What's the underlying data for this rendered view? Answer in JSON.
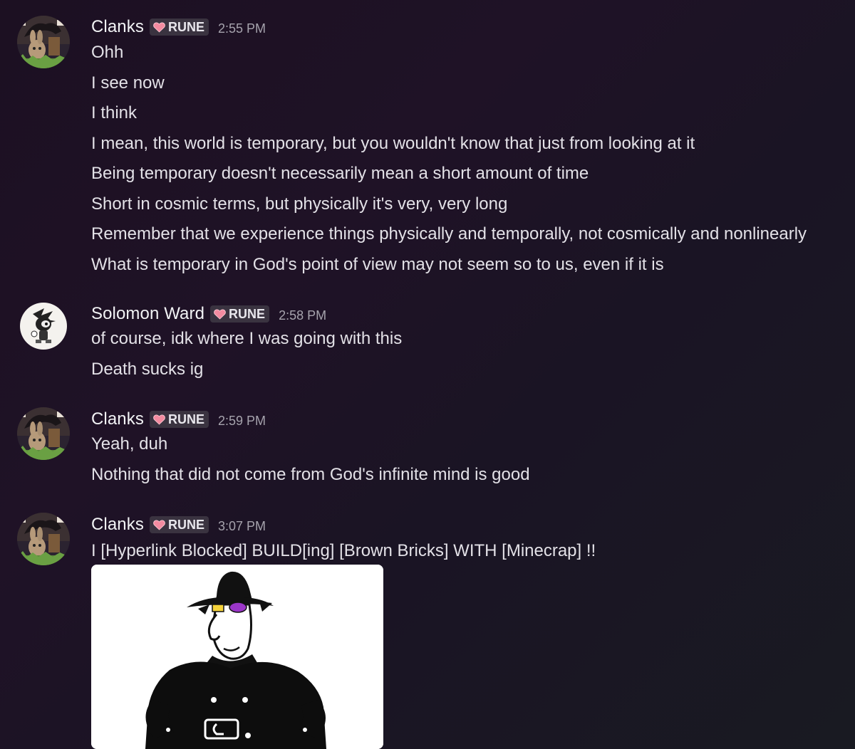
{
  "messages": [
    {
      "author": "Clanks",
      "tag": "RUNE",
      "time": "2:55 PM",
      "lines": [
        "Ohh",
        "I see now",
        "I think",
        "I mean, this world is temporary, but you wouldn't know that just from looking at it",
        "Being temporary doesn't necessarily mean a short amount of time",
        "Short in cosmic terms, but physically it's very, very long",
        "Remember that we experience things physically and temporally, not cosmically and nonlinearly",
        "What is temporary in God's point of view may not seem so to us, even if it is"
      ]
    },
    {
      "author": "Solomon Ward",
      "tag": "RUNE",
      "time": "2:58 PM",
      "lines": [
        "of course, idk where I was going with this",
        "Death sucks ig"
      ]
    },
    {
      "author": "Clanks",
      "tag": "RUNE",
      "time": "2:59 PM",
      "lines": [
        "Yeah, duh",
        "Nothing that did not come from God's infinite mind is good"
      ]
    },
    {
      "author": "Clanks",
      "tag": "RUNE",
      "time": "3:07 PM",
      "lines": [
        "I [Hyperlink Blocked] BUILD[ing] [Brown Bricks] WITH [Minecrap] !!"
      ],
      "attachment": "cartoon-character-image"
    }
  ],
  "colors": {
    "tag_heart": "#f38ba0",
    "timestamp": "#a6a3ad",
    "text": "#e3e1e7"
  }
}
